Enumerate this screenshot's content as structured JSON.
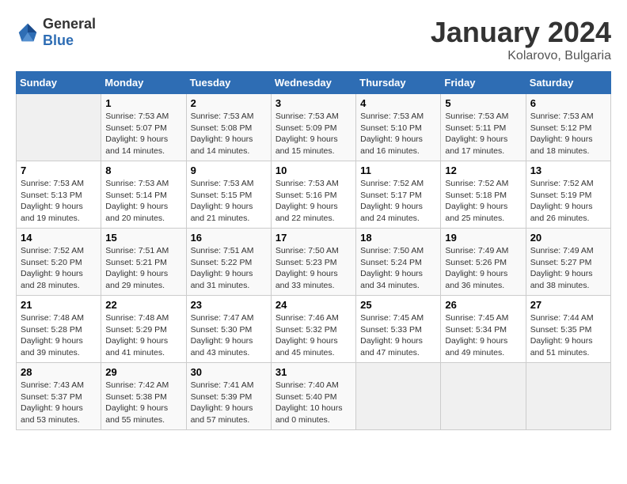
{
  "header": {
    "logo_general": "General",
    "logo_blue": "Blue",
    "month": "January 2024",
    "location": "Kolarovo, Bulgaria"
  },
  "weekdays": [
    "Sunday",
    "Monday",
    "Tuesday",
    "Wednesday",
    "Thursday",
    "Friday",
    "Saturday"
  ],
  "weeks": [
    [
      {
        "day": "",
        "sunrise": "",
        "sunset": "",
        "daylight": ""
      },
      {
        "day": "1",
        "sunrise": "Sunrise: 7:53 AM",
        "sunset": "Sunset: 5:07 PM",
        "daylight": "Daylight: 9 hours and 14 minutes."
      },
      {
        "day": "2",
        "sunrise": "Sunrise: 7:53 AM",
        "sunset": "Sunset: 5:08 PM",
        "daylight": "Daylight: 9 hours and 14 minutes."
      },
      {
        "day": "3",
        "sunrise": "Sunrise: 7:53 AM",
        "sunset": "Sunset: 5:09 PM",
        "daylight": "Daylight: 9 hours and 15 minutes."
      },
      {
        "day": "4",
        "sunrise": "Sunrise: 7:53 AM",
        "sunset": "Sunset: 5:10 PM",
        "daylight": "Daylight: 9 hours and 16 minutes."
      },
      {
        "day": "5",
        "sunrise": "Sunrise: 7:53 AM",
        "sunset": "Sunset: 5:11 PM",
        "daylight": "Daylight: 9 hours and 17 minutes."
      },
      {
        "day": "6",
        "sunrise": "Sunrise: 7:53 AM",
        "sunset": "Sunset: 5:12 PM",
        "daylight": "Daylight: 9 hours and 18 minutes."
      }
    ],
    [
      {
        "day": "7",
        "sunrise": "Sunrise: 7:53 AM",
        "sunset": "Sunset: 5:13 PM",
        "daylight": "Daylight: 9 hours and 19 minutes."
      },
      {
        "day": "8",
        "sunrise": "Sunrise: 7:53 AM",
        "sunset": "Sunset: 5:14 PM",
        "daylight": "Daylight: 9 hours and 20 minutes."
      },
      {
        "day": "9",
        "sunrise": "Sunrise: 7:53 AM",
        "sunset": "Sunset: 5:15 PM",
        "daylight": "Daylight: 9 hours and 21 minutes."
      },
      {
        "day": "10",
        "sunrise": "Sunrise: 7:53 AM",
        "sunset": "Sunset: 5:16 PM",
        "daylight": "Daylight: 9 hours and 22 minutes."
      },
      {
        "day": "11",
        "sunrise": "Sunrise: 7:52 AM",
        "sunset": "Sunset: 5:17 PM",
        "daylight": "Daylight: 9 hours and 24 minutes."
      },
      {
        "day": "12",
        "sunrise": "Sunrise: 7:52 AM",
        "sunset": "Sunset: 5:18 PM",
        "daylight": "Daylight: 9 hours and 25 minutes."
      },
      {
        "day": "13",
        "sunrise": "Sunrise: 7:52 AM",
        "sunset": "Sunset: 5:19 PM",
        "daylight": "Daylight: 9 hours and 26 minutes."
      }
    ],
    [
      {
        "day": "14",
        "sunrise": "Sunrise: 7:52 AM",
        "sunset": "Sunset: 5:20 PM",
        "daylight": "Daylight: 9 hours and 28 minutes."
      },
      {
        "day": "15",
        "sunrise": "Sunrise: 7:51 AM",
        "sunset": "Sunset: 5:21 PM",
        "daylight": "Daylight: 9 hours and 29 minutes."
      },
      {
        "day": "16",
        "sunrise": "Sunrise: 7:51 AM",
        "sunset": "Sunset: 5:22 PM",
        "daylight": "Daylight: 9 hours and 31 minutes."
      },
      {
        "day": "17",
        "sunrise": "Sunrise: 7:50 AM",
        "sunset": "Sunset: 5:23 PM",
        "daylight": "Daylight: 9 hours and 33 minutes."
      },
      {
        "day": "18",
        "sunrise": "Sunrise: 7:50 AM",
        "sunset": "Sunset: 5:24 PM",
        "daylight": "Daylight: 9 hours and 34 minutes."
      },
      {
        "day": "19",
        "sunrise": "Sunrise: 7:49 AM",
        "sunset": "Sunset: 5:26 PM",
        "daylight": "Daylight: 9 hours and 36 minutes."
      },
      {
        "day": "20",
        "sunrise": "Sunrise: 7:49 AM",
        "sunset": "Sunset: 5:27 PM",
        "daylight": "Daylight: 9 hours and 38 minutes."
      }
    ],
    [
      {
        "day": "21",
        "sunrise": "Sunrise: 7:48 AM",
        "sunset": "Sunset: 5:28 PM",
        "daylight": "Daylight: 9 hours and 39 minutes."
      },
      {
        "day": "22",
        "sunrise": "Sunrise: 7:48 AM",
        "sunset": "Sunset: 5:29 PM",
        "daylight": "Daylight: 9 hours and 41 minutes."
      },
      {
        "day": "23",
        "sunrise": "Sunrise: 7:47 AM",
        "sunset": "Sunset: 5:30 PM",
        "daylight": "Daylight: 9 hours and 43 minutes."
      },
      {
        "day": "24",
        "sunrise": "Sunrise: 7:46 AM",
        "sunset": "Sunset: 5:32 PM",
        "daylight": "Daylight: 9 hours and 45 minutes."
      },
      {
        "day": "25",
        "sunrise": "Sunrise: 7:45 AM",
        "sunset": "Sunset: 5:33 PM",
        "daylight": "Daylight: 9 hours and 47 minutes."
      },
      {
        "day": "26",
        "sunrise": "Sunrise: 7:45 AM",
        "sunset": "Sunset: 5:34 PM",
        "daylight": "Daylight: 9 hours and 49 minutes."
      },
      {
        "day": "27",
        "sunrise": "Sunrise: 7:44 AM",
        "sunset": "Sunset: 5:35 PM",
        "daylight": "Daylight: 9 hours and 51 minutes."
      }
    ],
    [
      {
        "day": "28",
        "sunrise": "Sunrise: 7:43 AM",
        "sunset": "Sunset: 5:37 PM",
        "daylight": "Daylight: 9 hours and 53 minutes."
      },
      {
        "day": "29",
        "sunrise": "Sunrise: 7:42 AM",
        "sunset": "Sunset: 5:38 PM",
        "daylight": "Daylight: 9 hours and 55 minutes."
      },
      {
        "day": "30",
        "sunrise": "Sunrise: 7:41 AM",
        "sunset": "Sunset: 5:39 PM",
        "daylight": "Daylight: 9 hours and 57 minutes."
      },
      {
        "day": "31",
        "sunrise": "Sunrise: 7:40 AM",
        "sunset": "Sunset: 5:40 PM",
        "daylight": "Daylight: 10 hours and 0 minutes."
      },
      {
        "day": "",
        "sunrise": "",
        "sunset": "",
        "daylight": ""
      },
      {
        "day": "",
        "sunrise": "",
        "sunset": "",
        "daylight": ""
      },
      {
        "day": "",
        "sunrise": "",
        "sunset": "",
        "daylight": ""
      }
    ]
  ]
}
